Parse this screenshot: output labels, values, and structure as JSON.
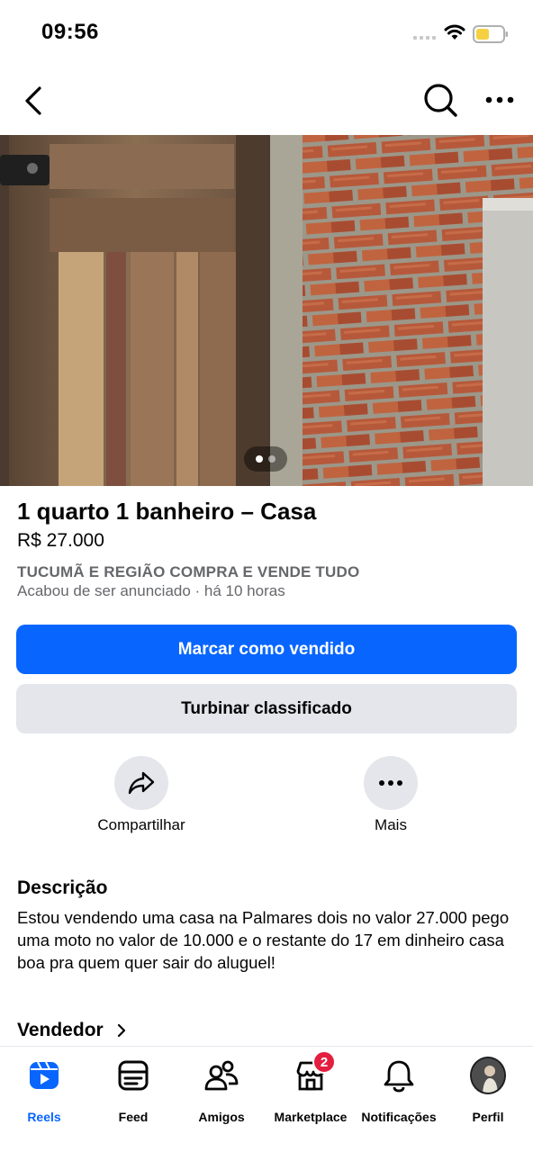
{
  "status_bar": {
    "time": "09:56"
  },
  "listing": {
    "title": "1 quarto 1 banheiro – Casa",
    "price": "R$ 27.000",
    "group": "TUCUMÃ E REGIÃO COMPRA E VENDE TUDO",
    "listed": "Acabou de ser anunciado  · há 10 horas",
    "image_count": 2,
    "image_index": 1
  },
  "buttons": {
    "mark_sold": "Marcar como vendido",
    "boost": "Turbinar classificado"
  },
  "actions": {
    "share": "Compartilhar",
    "more": "Mais"
  },
  "description": {
    "title": "Descrição",
    "text": " Estou vendendo uma casa na Palmares dois no valor 27.000 pego uma moto no valor de 10.000 e o restante do 17 em dinheiro casa boa pra quem quer sair do aluguel!"
  },
  "seller": {
    "title": "Vendedor"
  },
  "tab_bar": {
    "tabs": [
      {
        "label": "Reels",
        "icon": "reels-icon",
        "active": true
      },
      {
        "label": "Feed",
        "icon": "feed-icon"
      },
      {
        "label": "Amigos",
        "icon": "friends-icon"
      },
      {
        "label": "Marketplace",
        "icon": "marketplace-icon",
        "badge": "2"
      },
      {
        "label": "Notificações",
        "icon": "bell-icon"
      },
      {
        "label": "Perfil",
        "icon": "avatar"
      }
    ]
  },
  "colors": {
    "accent": "#0866ff",
    "secondary_button": "#e4e6eb",
    "muted_text": "#65676b",
    "badge": "#e41e3f"
  }
}
